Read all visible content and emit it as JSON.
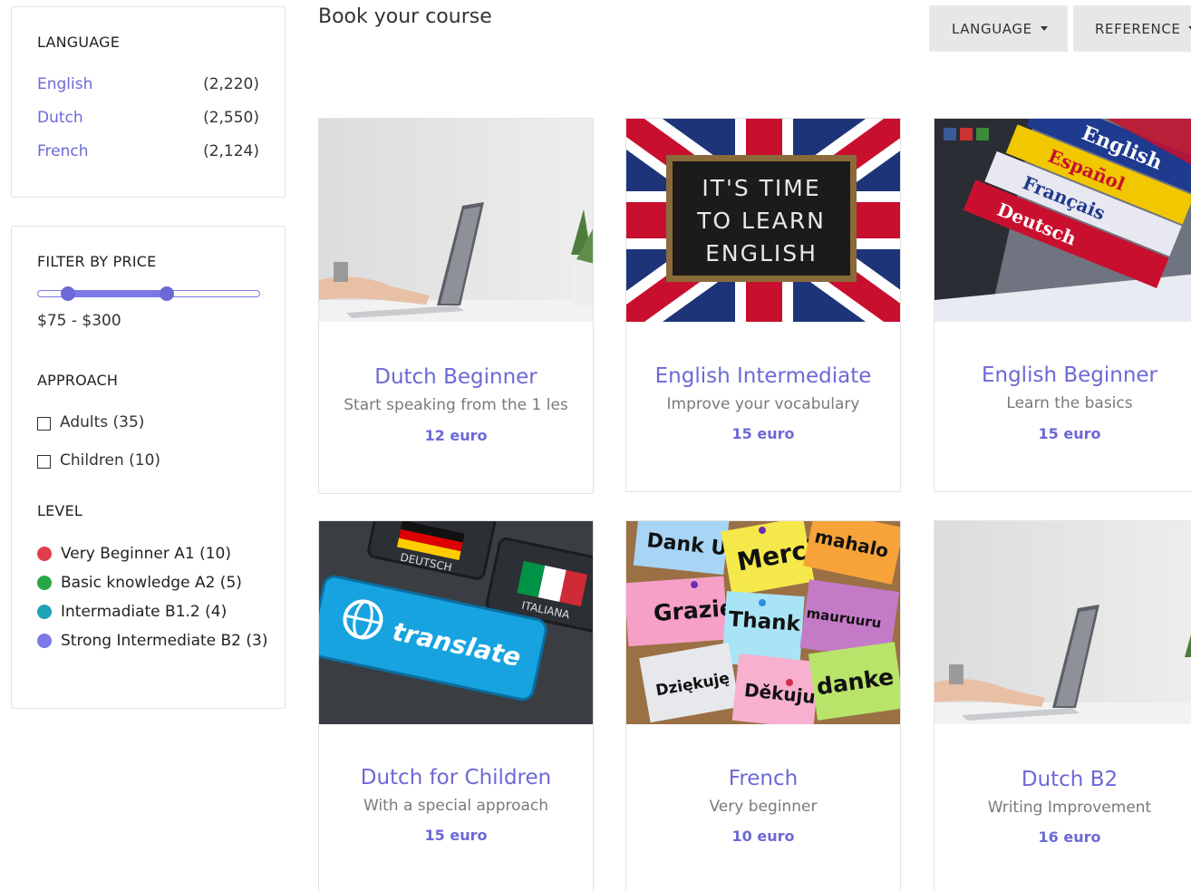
{
  "header": {
    "title": "Book your course",
    "dropdowns": [
      {
        "label": "LANGUAGE"
      },
      {
        "label": "REFERENCE"
      }
    ]
  },
  "sidebar": {
    "language": {
      "title": "LANGUAGE",
      "items": [
        {
          "label": "English",
          "count": "(2,220)"
        },
        {
          "label": "Dutch",
          "count": "(2,550)"
        },
        {
          "label": "French",
          "count": "(2,124)"
        }
      ]
    },
    "filter_price": {
      "title": "FILTER BY PRICE",
      "range_text": "$75 - $300",
      "range_min": 75,
      "range_max": 300
    },
    "approach": {
      "title": "APPROACH",
      "items": [
        {
          "label": "Adults (35)"
        },
        {
          "label": "Children (10)"
        }
      ]
    },
    "level": {
      "title": "LEVEL",
      "items": [
        {
          "label": "Very Beginner A1 (10)",
          "color": "#e23d4b"
        },
        {
          "label": "Basic knowledge A2 (5)",
          "color": "#29a745"
        },
        {
          "label": "Intermadiate B1.2 (4)",
          "color": "#1fa2b5"
        },
        {
          "label": "Strong Intermediate B2 (3)",
          "color": "#7b79e5"
        }
      ]
    }
  },
  "courses": [
    {
      "title": "Dutch Beginner",
      "subtitle": "Start speaking from the 1 les",
      "price": "12 euro",
      "image": "laptop-photo"
    },
    {
      "title": "English Intermediate",
      "subtitle": "Improve your vocabulary",
      "price": "15 euro",
      "image": "its-time-to-learn-english-photo",
      "image_text": [
        "IT'S TIME",
        "TO LEARN",
        "ENGLISH"
      ]
    },
    {
      "title": "English Beginner",
      "subtitle": "Learn the basics",
      "price": "15 euro",
      "image": "dictionaries-photo",
      "image_text": [
        "English",
        "Español",
        "Français",
        "Deutsch"
      ]
    },
    {
      "title": "Dutch for Children",
      "subtitle": "With a special approach",
      "price": "15 euro",
      "image": "translate-keyboard-photo",
      "image_text": [
        "translate",
        "DEUTSCH",
        "ITALIANA"
      ]
    },
    {
      "title": "French",
      "subtitle": "Very beginner",
      "price": "10 euro",
      "image": "thank-you-notes-photo",
      "image_text": [
        "Dank U",
        "Merci",
        "mahalo",
        "Grazie",
        "Thank you",
        "mauruuru",
        "Dziękuję",
        "Děkuju",
        "danke"
      ]
    },
    {
      "title": "Dutch B2",
      "subtitle": "Writing Improvement",
      "price": "16 euro",
      "image": "laptop-photo"
    }
  ],
  "colors": {
    "accent": "#6b69d6",
    "dropdown_bg": "#e7e7e7"
  }
}
